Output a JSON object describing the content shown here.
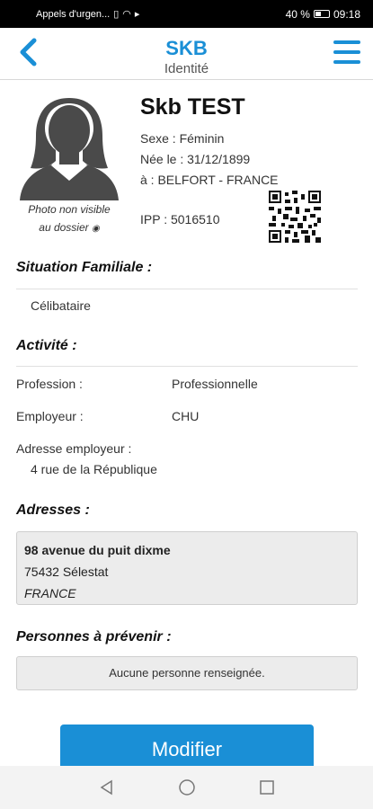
{
  "status_bar": {
    "carrier": "Appels d'urgen...",
    "battery": "40 %",
    "time": "09:18"
  },
  "header": {
    "title": "SKB",
    "subtitle": "Identité",
    "back_icon": "chevron-left-icon",
    "menu_icon": "hamburger-menu-icon"
  },
  "patient": {
    "name": "Skb TEST",
    "sex": "Sexe : Féminin",
    "birth": "Née le : 31/12/1899",
    "birthplace": "à : BELFORT - FRANCE",
    "ipp": "IPP : 5016510",
    "photo_note_line1": "Photo non visible",
    "photo_note_line2": "au dossier"
  },
  "sections": {
    "family_title": "Situation Familiale :",
    "family_value": "Célibataire",
    "activity_title": "Activité :",
    "profession_label": "Profession :",
    "profession_value": "Professionnelle",
    "employer_label": "Employeur :",
    "employer_value": "CHU",
    "employer_address_label": "Adresse employeur :",
    "employer_address_value": "4 rue de la République",
    "addresses_title": "Adresses :",
    "address_line1": "98 avenue du puit dixme",
    "address_line2": "75432 Sélestat",
    "address_line3": "FRANCE",
    "contacts_title": "Personnes à prévenir :",
    "contacts_empty": "Aucune personne renseignée."
  },
  "actions": {
    "modify_label": "Modifier"
  },
  "colors": {
    "accent": "#1a8fd6"
  }
}
